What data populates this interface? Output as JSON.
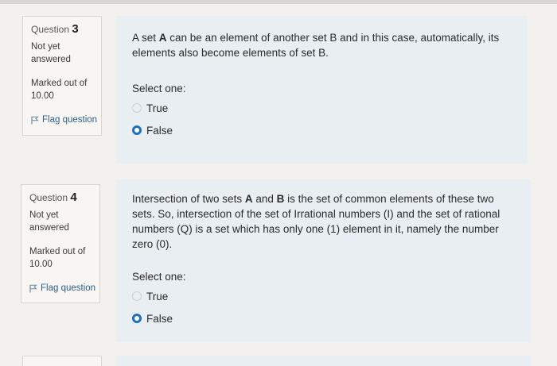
{
  "questions": [
    {
      "label": "Question",
      "number": "3",
      "state": "Not yet answered",
      "grade": "Marked out of 10.00",
      "flag_label": "Flag question",
      "text_parts": [
        "A set ",
        "A",
        " can be an element of another set B and in this case, automatically, its elements also become elements of set B."
      ],
      "prompt": "Select one:",
      "options": [
        {
          "label": "True",
          "selected": false
        },
        {
          "label": "False",
          "selected": true
        }
      ]
    },
    {
      "label": "Question",
      "number": "4",
      "state": "Not yet answered",
      "grade": "Marked out of 10.00",
      "flag_label": "Flag question",
      "text_parts": [
        "Intersection of two sets ",
        "A",
        " and ",
        "B",
        " is the set of common elements of these two sets. So, intersection of the set of Irrational numbers (I) and the set of rational numbers (Q) is a set which has only one (1) element in it, namely the number zero (0)."
      ],
      "prompt": "Select one:",
      "options": [
        {
          "label": "True",
          "selected": false
        },
        {
          "label": "False",
          "selected": true
        }
      ]
    }
  ],
  "colors": {
    "accent": "#1f6fbf",
    "flag_link": "#2f5d86",
    "content_bg": "#e8eef1",
    "info_bg": "#f7f6f3"
  }
}
